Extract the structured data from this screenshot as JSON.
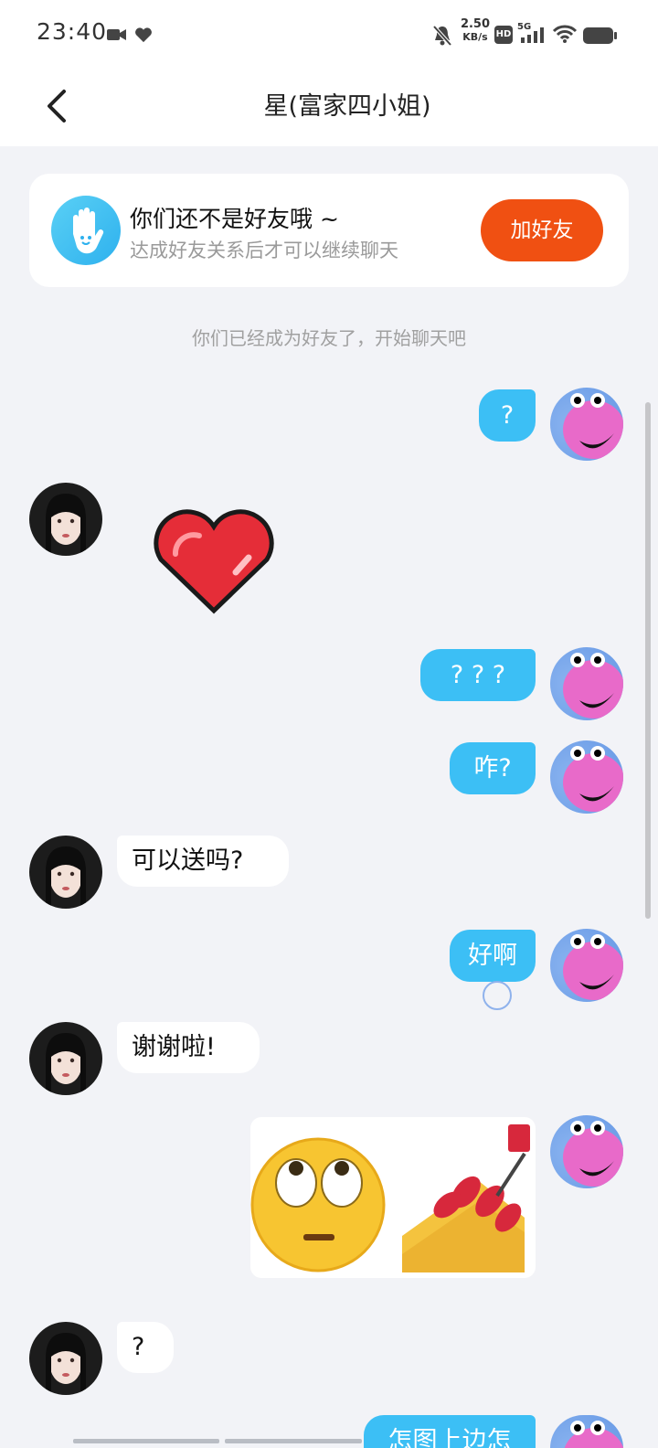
{
  "status_bar": {
    "time": "23:40",
    "net_speed_value": "2.50",
    "net_speed_unit": "KB/s",
    "hd_label": "HD",
    "network_label": "5G",
    "icons": [
      "video-camera-icon",
      "heart-icon",
      "bell-muted-icon",
      "hd-icon",
      "signal-icon",
      "wifi-icon",
      "battery-icon"
    ]
  },
  "header": {
    "title": "星(富家四小姐)",
    "back_icon": "chevron-left-icon"
  },
  "friend_card": {
    "title": "你们还不是好友哦 ~",
    "subtitle": "达成好友关系后才可以继续聊天",
    "button_label": "加好友",
    "icon": "wave-hand-icon"
  },
  "system_notice": "你们已经成为好友了，开始聊天吧",
  "messages": [
    {
      "side": "out",
      "type": "text",
      "text": "?"
    },
    {
      "side": "in",
      "type": "sticker",
      "sticker": "red-heart-sticker"
    },
    {
      "side": "out",
      "type": "text",
      "text": "? ? ?"
    },
    {
      "side": "out",
      "type": "text",
      "text": "咋?"
    },
    {
      "side": "in",
      "type": "text",
      "text": "可以送吗?"
    },
    {
      "side": "out",
      "type": "text",
      "text": "好啊"
    },
    {
      "side": "in",
      "type": "text",
      "text": "谢谢啦!"
    },
    {
      "side": "out",
      "type": "sticker",
      "sticker": "eye-roll-nail-polish-sticker"
    },
    {
      "side": "in",
      "type": "text",
      "text": "?"
    },
    {
      "side": "out",
      "type": "text",
      "text": "怎图上边怎"
    }
  ],
  "colors": {
    "outgoing_bubble": "#3cbff5",
    "incoming_bubble": "#ffffff",
    "add_friend_button": "#f05012",
    "background": "#f2f3f7"
  }
}
